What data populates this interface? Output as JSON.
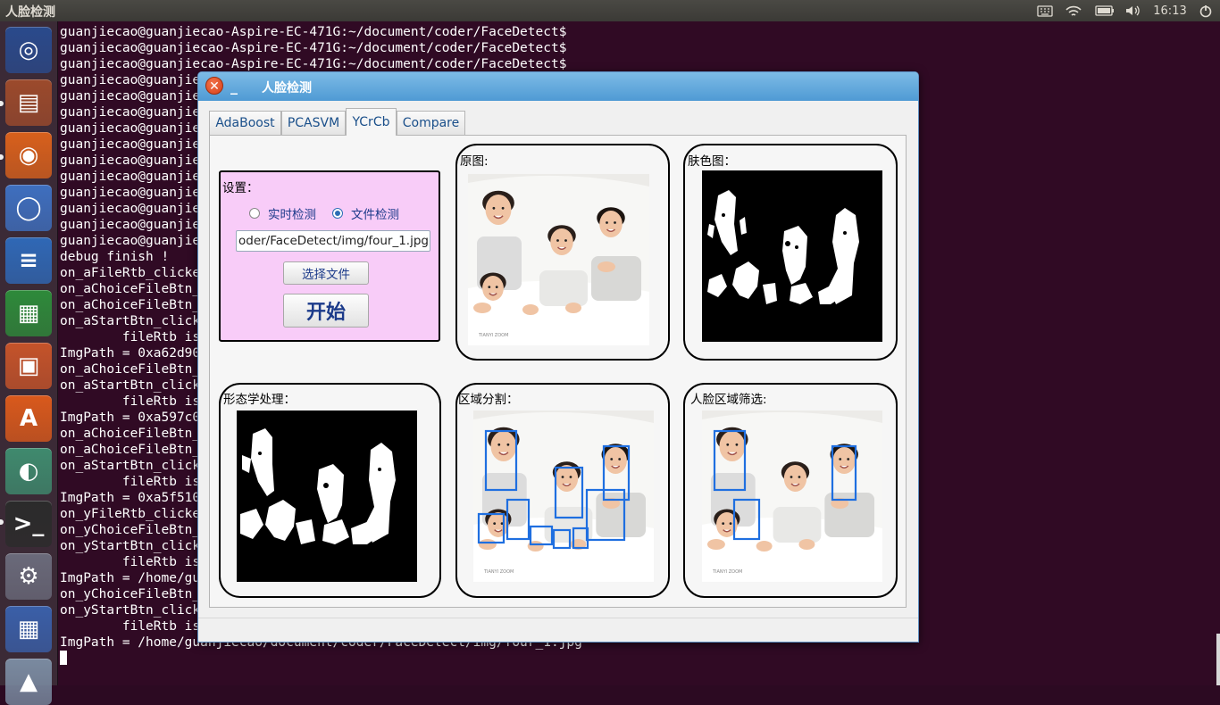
{
  "top_panel": {
    "app_title": "人脸检测",
    "clock": "16:13",
    "indicators": [
      "keyboard-icon",
      "wifi-icon",
      "battery-icon",
      "volume-icon",
      "power-icon"
    ]
  },
  "launcher": {
    "items": [
      {
        "name": "ubuntu-dash",
        "glyph": "◎",
        "color": "#2a4a8c"
      },
      {
        "name": "files",
        "glyph": "▤",
        "color": "#9c4a2c"
      },
      {
        "name": "firefox",
        "glyph": "◉",
        "color": "#d8601c"
      },
      {
        "name": "chromium",
        "glyph": "◯",
        "color": "#3e6fbf"
      },
      {
        "name": "libreoffice-writer",
        "glyph": "≡",
        "color": "#2f68b6"
      },
      {
        "name": "libreoffice-calc",
        "glyph": "▦",
        "color": "#2e8a3a"
      },
      {
        "name": "libreoffice-impress",
        "glyph": "▣",
        "color": "#c5532a"
      },
      {
        "name": "software-center",
        "glyph": "A",
        "color": "#d9591c"
      },
      {
        "name": "face-app",
        "glyph": "◐",
        "color": "#3f8a6e"
      },
      {
        "name": "terminal",
        "glyph": ">_",
        "color": "#2b2b2b"
      },
      {
        "name": "system-settings",
        "glyph": "⚙",
        "color": "#6a6a7a"
      },
      {
        "name": "workspace-switcher",
        "glyph": "▦",
        "color": "#3a5fa8"
      },
      {
        "name": "trash",
        "glyph": "▲",
        "color": "#7a8aa0"
      }
    ]
  },
  "terminal": {
    "lines": [
      "guanjiecao@guanjiecao-Aspire-EC-471G:~/document/coder/FaceDetect$",
      "guanjiecao@guanjiecao-Aspire-EC-471G:~/document/coder/FaceDetect$",
      "guanjiecao@guanjiecao-Aspire-EC-471G:~/document/coder/FaceDetect$",
      "guanjiecao@guanjiecao-Aspire-EC-471G:~/document/coder/FaceDetect$",
      "guanjiecao@guanjiecao-Aspire-EC-471G:~/document/coder/FaceDetect$",
      "guanjiecao@guanjiecao-Aspire-EC-471G:~/document/coder/FaceDetect$",
      "guanjiecao@guanjiecao-Aspire-EC-471G:~/document/coder/FaceDetect$",
      "guanjiecao@guanjiecao-Aspire-EC-471G:~/document/coder/FaceDetect$",
      "guanjiecao@guanjiecao-Aspire-EC-471G:~/document/coder/FaceDetect$",
      "guanjiecao@guanjiecao-Aspire-EC-471G:~/document/coder/FaceDetect$",
      "guanjiecao@guanjiecao-Aspire-EC-471G:~/document/coder/FaceDetect$",
      "guanjiecao@guanjiecao-Aspire-EC-471G:~/document/coder/FaceDetect$",
      "guanjiecao@guanjiecao-Aspire-EC-471G:~/document/coder/FaceDetect$",
      "guanjiecao@guanjiecao-Aspire-EC-471G:~/document/coder/FaceDetect$",
      "debug finish !",
      "on_aFileRtb_clicked",
      "on_aChoiceFileBtn_clicked",
      "on_aChoiceFileBtn_clicked",
      "on_aStartBtn_clicked",
      "        fileRtb is checked",
      "ImgPath = 0xa62d90",
      "on_aChoiceFileBtn_clicked",
      "on_aStartBtn_clicked",
      "        fileRtb is checked",
      "ImgPath = 0xa597c0",
      "on_aChoiceFileBtn_clicked",
      "on_aChoiceFileBtn_clicked",
      "on_aStartBtn_clicked",
      "        fileRtb is checked",
      "ImgPath = 0xa5f510",
      "on_yFileRtb_clicked",
      "on_yChoiceFileBtn_clicked",
      "on_yStartBtn_clicked",
      "        fileRtb is checked",
      "ImgPath = /home/guanjiecao/document/coder/FaceDetect/img/four_1.jpg",
      "on_yChoiceFileBtn_clicked",
      "on_yStartBtn_clicked",
      "        fileRtb is checked",
      "ImgPath = /home/guanjiecao/document/coder/FaceDetect/img/four_1.jpg"
    ]
  },
  "window": {
    "title": "人脸检测",
    "tabs": [
      "AdaBoost",
      "PCASVM",
      "YCrCb",
      "Compare"
    ],
    "active_tab": "YCrCb",
    "settings": {
      "label": "设置：",
      "radio_realtime": "实时检测",
      "radio_file": "文件检测",
      "selected": "文件检测",
      "path_value": "oder/FaceDetect/img/four_1.jpg",
      "choose_file_button": "选择文件",
      "start_button": "开始"
    },
    "panels": {
      "original": "原图:",
      "skin": "肤色图：",
      "morphology": "形态学处理：",
      "segmentation": "区域分割：",
      "face_filter": "人脸区域筛选:"
    },
    "photo_watermark": "TIANYI ZOOM"
  },
  "colors": {
    "terminal_bg": "#300a24",
    "titlebar": "#5da5dc",
    "settings_bg": "#f8ccf8",
    "box_blue": "#1f6fe0"
  }
}
